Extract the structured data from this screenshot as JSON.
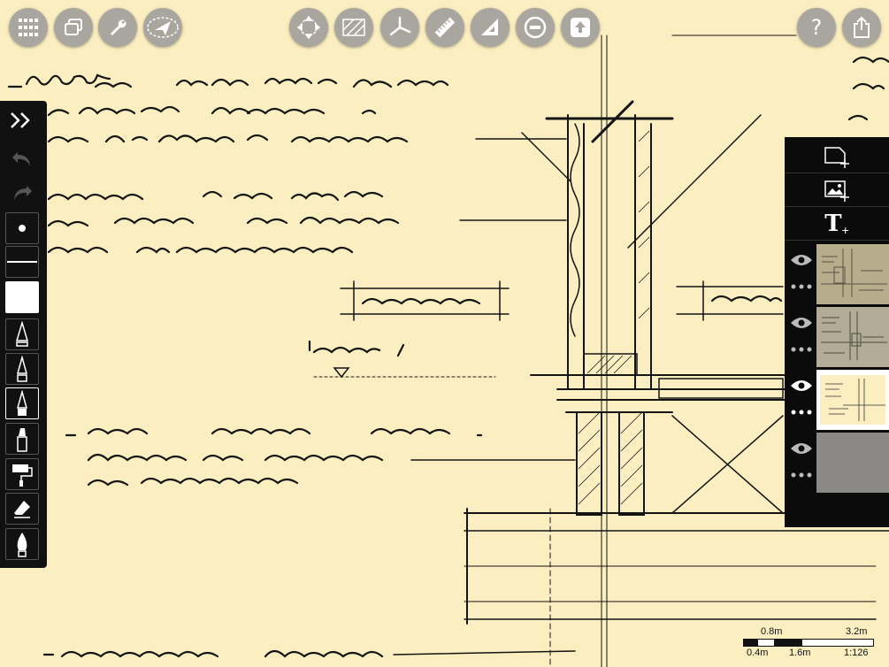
{
  "toolbar": {
    "left": [
      {
        "name": "grid-menu-icon"
      },
      {
        "name": "windows-icon"
      },
      {
        "name": "wrench-icon"
      },
      {
        "name": "navigate-icon"
      }
    ],
    "center": [
      {
        "name": "transform-icon"
      },
      {
        "name": "hatch-icon"
      },
      {
        "name": "axis-icon"
      },
      {
        "name": "ruler-icon"
      },
      {
        "name": "set-square-icon"
      },
      {
        "name": "minus-circle-icon"
      },
      {
        "name": "upload-icon"
      }
    ],
    "right": [
      {
        "name": "help-icon",
        "label": "?"
      },
      {
        "name": "share-icon"
      }
    ]
  },
  "toolbox": {
    "items": [
      "collapse",
      "undo",
      "redo",
      "brush-dot",
      "line-weight",
      "color-swatch",
      "pencil",
      "technical-pen",
      "fineliner",
      "marker",
      "roller",
      "eraser",
      "fill-pen"
    ],
    "color_swatch": "#ffffff"
  },
  "layers_panel": {
    "actions": [
      "new-layer",
      "image-layer",
      "text-layer"
    ],
    "text_icon_label": "T",
    "layers": [
      {
        "visible": true,
        "has_thumb": true,
        "selected": false
      },
      {
        "visible": true,
        "has_thumb": true,
        "selected": false
      },
      {
        "visible": true,
        "has_thumb": true,
        "selected": true
      },
      {
        "visible": true,
        "has_thumb": false,
        "selected": false
      }
    ]
  },
  "scale_bar": {
    "top_labels": [
      "0.8m",
      "3.2m"
    ],
    "bottom_labels": [
      "0.4m",
      "1.6m"
    ],
    "ratio": "1:126"
  },
  "colors": {
    "paper": "#fbefc1",
    "ink": "#141414",
    "toolbar_button": "#a9a6a0",
    "panel": "#0b0b0b"
  }
}
